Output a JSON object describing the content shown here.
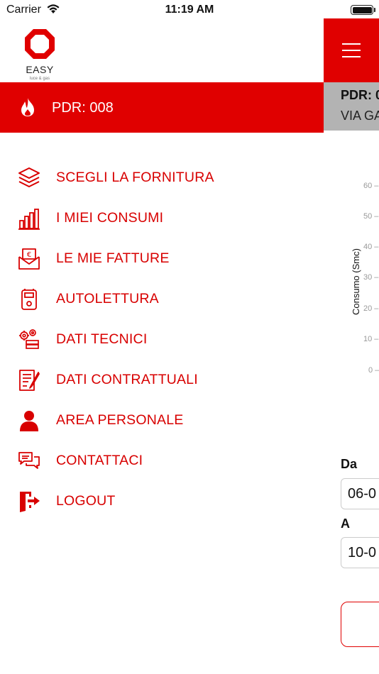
{
  "status_bar": {
    "carrier": "Carrier",
    "time": "11:19 AM"
  },
  "brand": {
    "name": "EASY",
    "tagline": "luce & gas",
    "accent_color": "#e00000"
  },
  "drawer": {
    "pdr_label": "PDR: 008",
    "menu": [
      {
        "label": "SCEGLI LA FORNITURA",
        "icon": "layers-icon"
      },
      {
        "label": "I MIEI CONSUMI",
        "icon": "bar-chart-icon"
      },
      {
        "label": "LE MIE FATTURE",
        "icon": "invoice-envelope-icon"
      },
      {
        "label": "AUTOLETTURA",
        "icon": "gas-meter-icon"
      },
      {
        "label": "DATI TECNICI",
        "icon": "gears-icon"
      },
      {
        "label": "DATI CONTRATTUALI",
        "icon": "contract-icon"
      },
      {
        "label": "AREA PERSONALE",
        "icon": "user-icon"
      },
      {
        "label": "CONTATTACI",
        "icon": "chat-icon"
      },
      {
        "label": "LOGOUT",
        "icon": "logout-icon"
      }
    ]
  },
  "main": {
    "pdr_title": "PDR: 0",
    "pdr_address": "VIA GA",
    "chart_ylabel": "Consumo (Smc)",
    "chart_ticks": [
      "60 –",
      "50 –",
      "40 –",
      "30 –",
      "20 –",
      "10 –",
      "0 –"
    ],
    "from_label": "Da",
    "from_value": "06-0",
    "to_label": "A",
    "to_value": "10-0"
  }
}
